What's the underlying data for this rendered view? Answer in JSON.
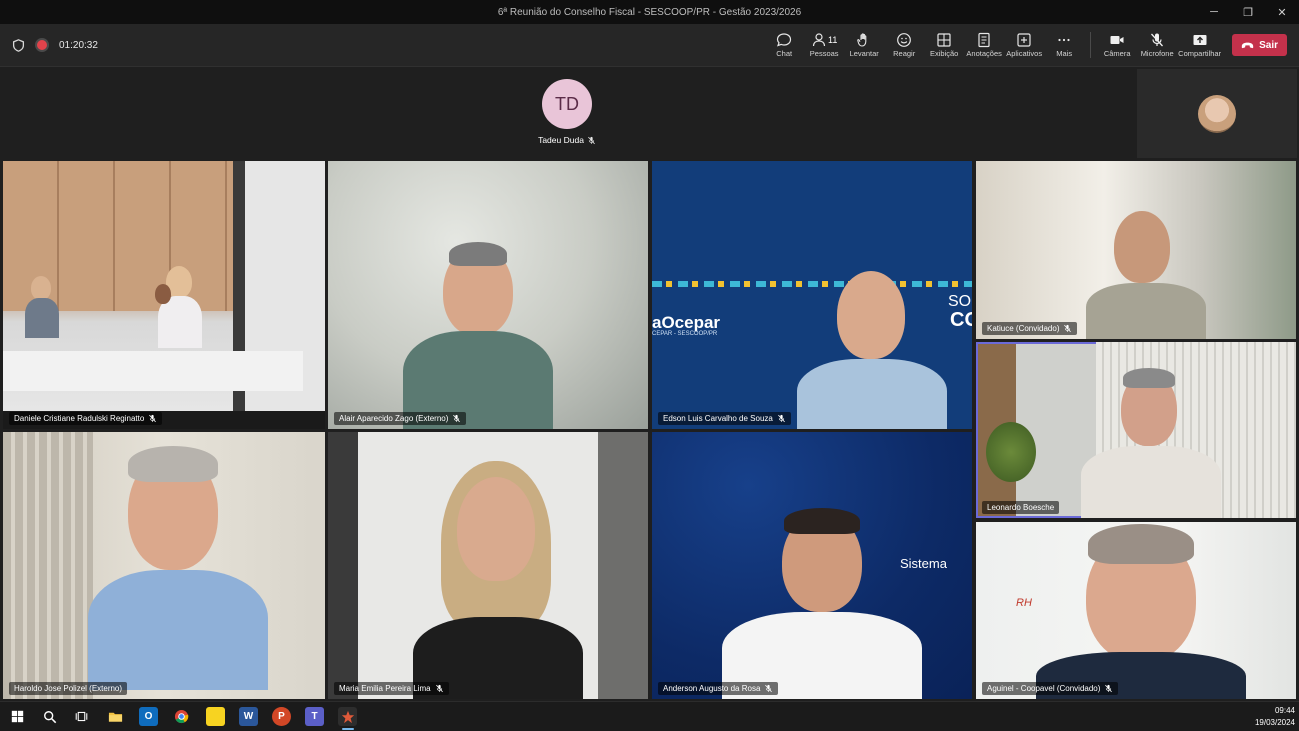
{
  "window": {
    "title": "6ª Reunião do Conselho Fiscal - SESCOOP/PR - Gestão 2023/2026",
    "controls": [
      "─",
      "❐",
      "✕"
    ]
  },
  "meeting": {
    "timer": "01:20:32"
  },
  "toolbar": {
    "chat": "Chat",
    "people": "Pessoas",
    "people_count": "11",
    "raise": "Levantar",
    "react": "Reagir",
    "view": "Exibição",
    "notes": "Anotações",
    "apps": "Aplicativos",
    "more": "Mais",
    "camera": "Câmera",
    "mic": "Microfone",
    "share": "Compartilhar",
    "leave": "Sair",
    "leave_color": "#c4314b"
  },
  "spotlight": {
    "initials": "TD",
    "name": "Tadeu Duda"
  },
  "participants": [
    {
      "name": "Daniele Cristiane Radulski Reginatto"
    },
    {
      "name": "Alair Aparecido Zago (Externo)"
    },
    {
      "name": "Edson Luis Carvalho de Souza"
    },
    {
      "name": "Katiuce (Convidado)"
    },
    {
      "name": "Leonardo Boesche"
    },
    {
      "name": "Haroldo Jose Polizel (Externo)"
    },
    {
      "name": "Maria Emilia Pereira Lima"
    },
    {
      "name": "Anderson Augusto da Rosa"
    },
    {
      "name": "Aguinel - Coopavel (Convidado)"
    }
  ],
  "backgrounds": {
    "ocepar_text": "aOcepar",
    "ocepar_sub": "CEPAR - SESCOOP/PR",
    "so_text": "SO",
    "co_text": "CO",
    "sistema_text": "Sistema",
    "rh_text": "RH"
  },
  "taskbar": {
    "time": "09:44",
    "date": "19/03/2024"
  }
}
